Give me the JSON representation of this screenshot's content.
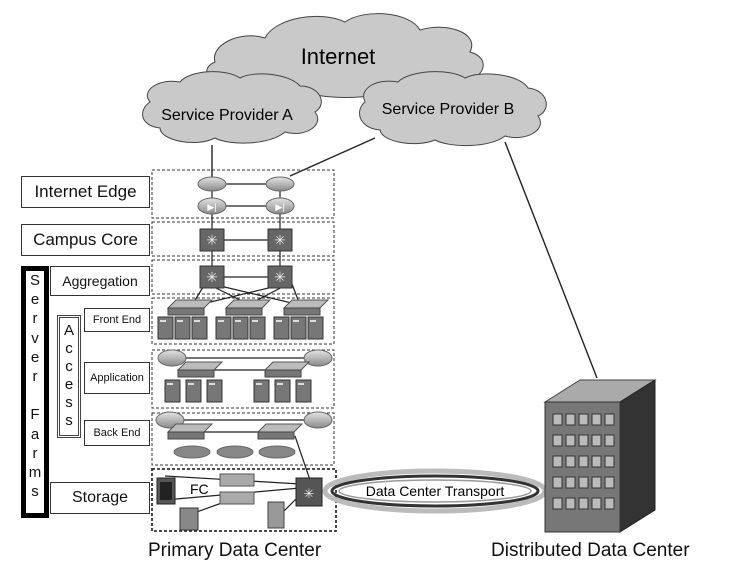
{
  "clouds": {
    "internet": "Internet",
    "provider_a": "Service Provider A",
    "provider_b": "Service Provider B"
  },
  "layers": {
    "internet_edge": "Internet Edge",
    "campus_core": "Campus Core",
    "aggregation": "Aggregation",
    "front_end": "Front End",
    "application": "Application",
    "back_end": "Back End",
    "storage": "Storage"
  },
  "groups": {
    "server_farms_letters": [
      "S",
      "e",
      "r",
      "v",
      "e",
      "r",
      " ",
      "F",
      "a",
      "r",
      "m",
      "s"
    ],
    "access_letters": [
      "A",
      "c",
      "c",
      "e",
      "s",
      "s"
    ]
  },
  "storage_label": "FC",
  "transport": "Data Center Transport",
  "captions": {
    "primary": "Primary Data Center",
    "distributed": "Distributed Data Center"
  }
}
